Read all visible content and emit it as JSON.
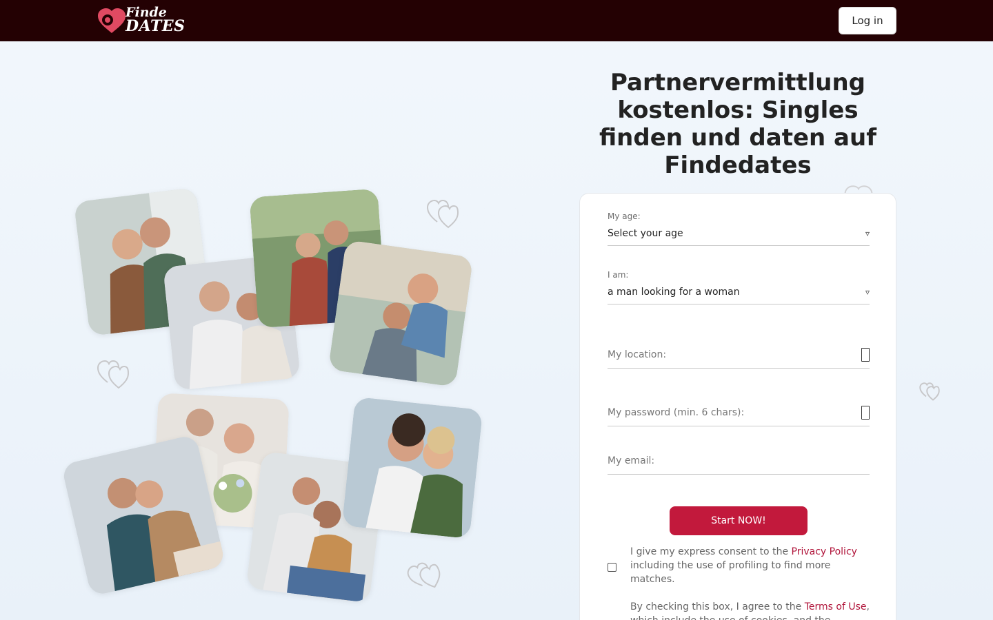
{
  "header": {
    "logo_line1": "Finde",
    "logo_line2": "DATES",
    "login_label": "Log in"
  },
  "headline": "Partnervermittlung kostenlos: Singles finden und daten auf Findedates",
  "form": {
    "age_label": "My age:",
    "age_value": "Select your age",
    "iam_label": "I am:",
    "iam_value": "a man looking for a woman",
    "location_placeholder": "My location:",
    "password_placeholder": "My password (min. 6 chars):",
    "email_placeholder": "My email:",
    "start_label": "Start NOW!",
    "consent_prefix": "I give my express consent to the ",
    "privacy_link": "Privacy Policy",
    "consent_suffix": " including the use of profiling to find more matches.",
    "terms_prefix": "By checking this box, I agree to the ",
    "terms_link": "Terms of Use",
    "terms_suffix": ", which include the use of cookies, and the"
  },
  "colors": {
    "header_bg": "#240103",
    "accent": "#c2193c",
    "link": "#b0143a"
  },
  "icons": {
    "logo": "heart-pin-icon",
    "decor": "double-heart-icon",
    "field_icon": "placeholder-box-icon",
    "select_caret": "caret-down-icon"
  }
}
